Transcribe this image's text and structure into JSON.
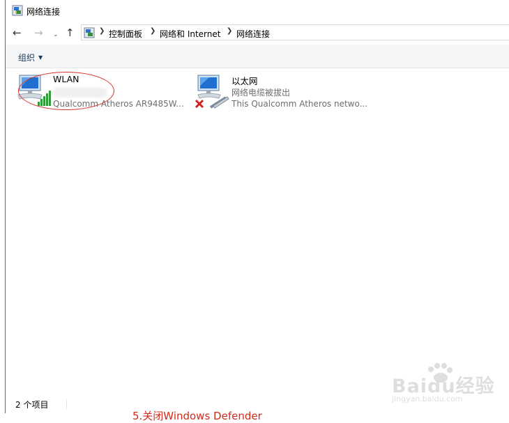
{
  "window": {
    "title": "网络连接"
  },
  "nav": {
    "back_label": "←",
    "forward_label": "→",
    "recent_label": "⌄",
    "up_label": "↑"
  },
  "address": {
    "crumbs": [
      "控制面板",
      "网络和 Internet",
      "网络连接"
    ]
  },
  "toolbar": {
    "organize_label": "组织"
  },
  "connections": [
    {
      "name": "WLAN",
      "status": "",
      "device": "Qualcomm Atheros AR9485W...",
      "type": "wireless"
    },
    {
      "name": "以太网",
      "status": "网络电缆被拔出",
      "device": "This Qualcomm Atheros netwo...",
      "type": "ethernet-disconnected"
    }
  ],
  "statusbar": {
    "item_count": "2 个项目"
  },
  "overlay": {
    "bottom_text": "5.关闭Windows Defender",
    "watermark_text": "Baidu经验",
    "watermark_sub": "jingyan.baidu.com"
  },
  "colors": {
    "highlight_ring": "#d6322e",
    "accent_blue": "#2b79d4"
  }
}
